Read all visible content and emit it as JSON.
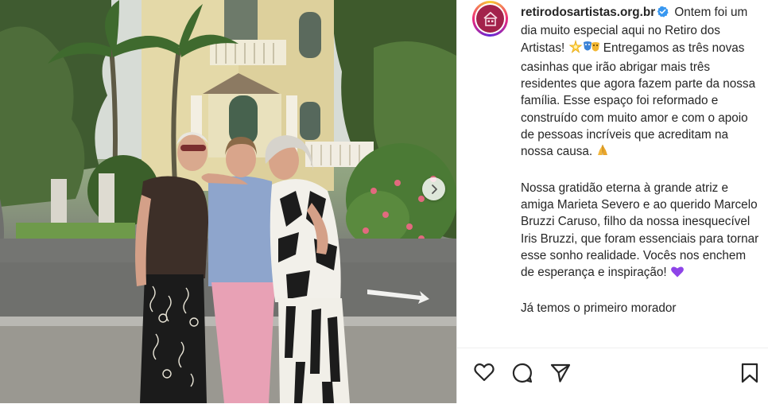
{
  "post": {
    "author": "retirodosartistas.org.br",
    "verified": true,
    "caption": {
      "p1_text_a": "Ontem foi um dia muito especial aqui no Retiro dos Artistas!",
      "p1_text_b": "Entregamos as três novas casinhas que irão abrigar mais três residentes que agora fazem parte da nossa família. Esse espaço foi reformado e construído com muito amor e com o apoio de pessoas incríveis que acreditam na nossa causa.",
      "p2": "Nossa gratidão eterna à grande atriz e amiga Marieta Severo e ao querido Marcelo Bruzzi Caruso, filho da nossa inesquecível Iris Bruzzi, que foram essenciais para tornar esse sonho realidade. Vocês nos enchem de esperança e inspiração!",
      "p3": "Já temos o primeiro morador"
    },
    "emojis": [
      "sparkle-emoji",
      "theater-masks-emoji",
      "praying-hands-emoji",
      "purple-heart-emoji"
    ],
    "colors": {
      "avatar": "#a3224b",
      "verified": "#3897f0",
      "heart": "#8e44e8"
    }
  },
  "actions": [
    "like-icon",
    "comment-icon",
    "share-icon",
    "save-icon"
  ],
  "media": {
    "carousel_next": "chevron-right-icon"
  }
}
